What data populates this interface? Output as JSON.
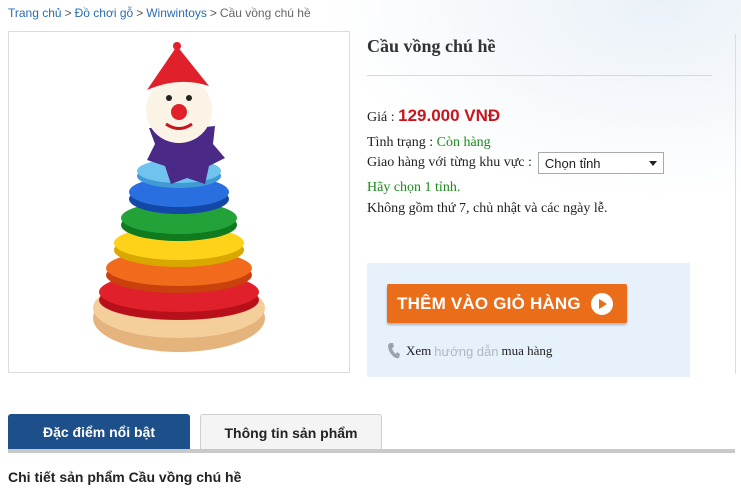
{
  "breadcrumb": {
    "items": [
      "Trang chủ",
      "Đồ chơi gỗ",
      "Winwintoys"
    ],
    "separator": ">",
    "current": "Cầu vồng chú hề"
  },
  "product": {
    "title": "Cầu vồng chú hề",
    "price_label": "Giá :",
    "price": "129.000 VNĐ",
    "status_label": "Tình trạng :",
    "status": "Còn hàng",
    "shipping_label": "Giao hàng với từng khu vực :",
    "region_select": "Chọn tỉnh",
    "region_hint": "Hãy chọn 1 tỉnh.",
    "note": "Không gồm thứ 7, chủ nhật và các ngày lễ."
  },
  "cart": {
    "button_label": "THÊM VÀO GIỎ HÀNG",
    "guide_prefix": "Xem",
    "guide_link": "hướng dẫn",
    "guide_suffix": "mua hàng"
  },
  "tabs": [
    {
      "label": "Đặc điểm nổi bật",
      "active": true
    },
    {
      "label": "Thông tin sản phẩm",
      "active": false
    }
  ],
  "section": {
    "title": "Chi tiết sản phẩm Cầu vồng chú hề"
  },
  "colors": {
    "price": "#c8161d",
    "in_stock": "#1a8a1a",
    "cart_button": "#ea6d1a",
    "tab_active": "#1d4f8b",
    "link": "#2a6cb3"
  },
  "icons": [
    "phone-icon",
    "play-circle-icon",
    "chevron-down-icon"
  ]
}
